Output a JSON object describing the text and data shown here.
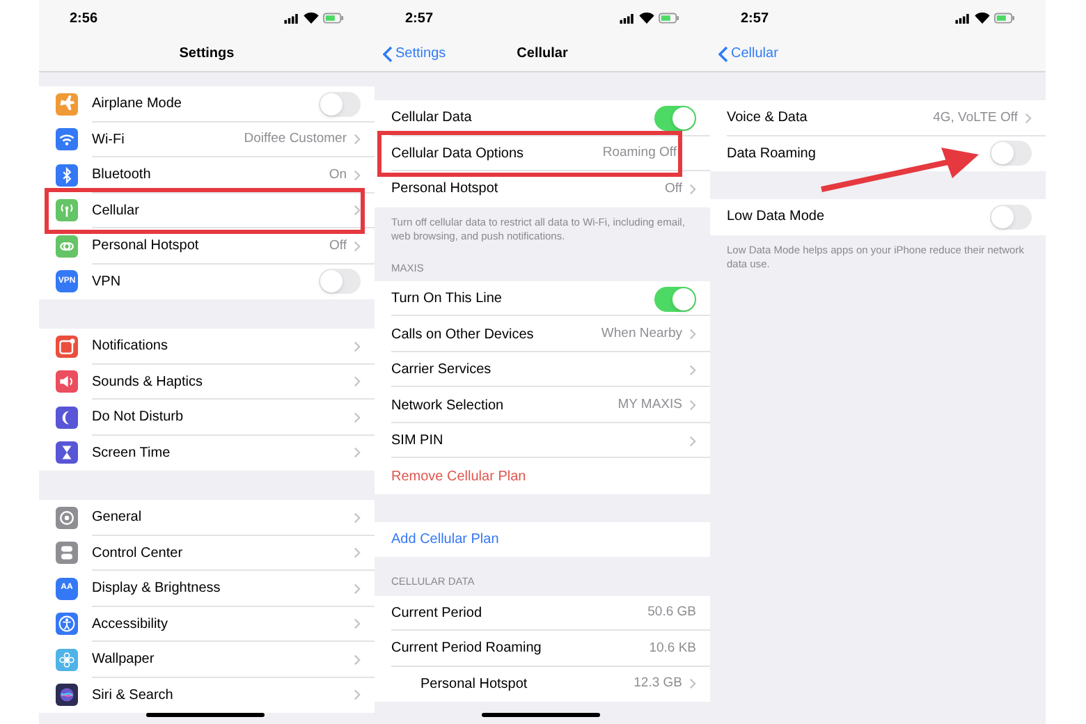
{
  "screens": [
    {
      "status_bar": {
        "time": "2:56"
      },
      "nav": {
        "title": "Settings"
      },
      "home_indicator": true,
      "groups": [
        {
          "rows": [
            {
              "kind": "toggle",
              "label": "Airplane Mode",
              "on": false,
              "color": "#f09a37",
              "highlighted": false
            },
            {
              "kind": "disclosure",
              "label": "Wi-Fi",
              "value": "Doiffee Customer",
              "color": "#3478f6",
              "highlighted": false
            },
            {
              "kind": "disclosure",
              "label": "Bluetooth",
              "value": "On",
              "color": "#3478f6",
              "highlighted": false
            },
            {
              "kind": "disclosure",
              "label": "Cellular",
              "color": "#65c466",
              "highlighted": true
            },
            {
              "kind": "disclosure",
              "label": "Personal Hotspot",
              "value": "Off",
              "color": "#65c466",
              "highlighted": false
            },
            {
              "kind": "toggle",
              "label": "VPN",
              "on": false,
              "color": "#3478f6",
              "icon_text": "VPN",
              "highlighted": false
            }
          ]
        },
        {
          "rows": [
            {
              "kind": "disclosure",
              "label": "Notifications",
              "color": "#eb4e3d",
              "highlighted": false
            },
            {
              "kind": "disclosure",
              "label": "Sounds & Haptics",
              "color": "#eb4e5f",
              "highlighted": false
            },
            {
              "kind": "disclosure",
              "label": "Do Not Disturb",
              "color": "#5856d6",
              "highlighted": false
            },
            {
              "kind": "disclosure",
              "label": "Screen Time",
              "color": "#5856d6",
              "highlighted": false
            }
          ]
        },
        {
          "rows": [
            {
              "kind": "disclosure",
              "label": "General",
              "color": "#8e8e93",
              "highlighted": false
            },
            {
              "kind": "disclosure",
              "label": "Control Center",
              "color": "#8e8e93",
              "highlighted": false
            },
            {
              "kind": "disclosure",
              "label": "Display & Brightness",
              "color": "#3478f6",
              "icon_text": "AA",
              "highlighted": false
            },
            {
              "kind": "disclosure",
              "label": "Accessibility",
              "color": "#3478f6",
              "highlighted": false
            },
            {
              "kind": "disclosure",
              "label": "Wallpaper",
              "color": "#4fb3e8",
              "highlighted": false
            },
            {
              "kind": "disclosure",
              "label": "Siri & Search",
              "color": "#2c2c54",
              "highlighted": false
            }
          ]
        }
      ]
    },
    {
      "status_bar": {
        "time": "2:57"
      },
      "nav": {
        "back": "Settings",
        "title": "Cellular"
      },
      "home_indicator": true,
      "groups": [
        {
          "rows": [
            {
              "kind": "toggle",
              "label": "Cellular Data",
              "on": true,
              "highlighted": false
            },
            {
              "kind": "value",
              "label": "Cellular Data Options",
              "value": "Roaming Off",
              "highlighted": true
            },
            {
              "kind": "disclosure",
              "label": "Personal Hotspot",
              "value": "Off",
              "highlighted": false
            }
          ],
          "footer": "Turn off cellular data to restrict all data to Wi-Fi, including email, web browsing, and push notifications."
        },
        {
          "header": "MAXIS",
          "rows": [
            {
              "kind": "toggle",
              "label": "Turn On This Line",
              "on": true,
              "highlighted": false
            },
            {
              "kind": "disclosure",
              "label": "Calls on Other Devices",
              "value": "When Nearby",
              "highlighted": false
            },
            {
              "kind": "disclosure",
              "label": "Carrier Services",
              "highlighted": false
            },
            {
              "kind": "disclosure",
              "label": "Network Selection",
              "value": "MY MAXIS",
              "highlighted": false
            },
            {
              "kind": "disclosure",
              "label": "SIM PIN",
              "highlighted": false
            },
            {
              "kind": "destructive",
              "label": "Remove Cellular Plan",
              "highlighted": false
            }
          ]
        },
        {
          "rows": [
            {
              "kind": "action",
              "label": "Add Cellular Plan",
              "highlighted": false
            }
          ]
        },
        {
          "header": "CELLULAR DATA",
          "rows": [
            {
              "kind": "value",
              "label": "Current Period",
              "value": "50.6 GB",
              "highlighted": false
            },
            {
              "kind": "value",
              "label": "Current Period Roaming",
              "value": "10.6 KB",
              "highlighted": false
            },
            {
              "kind": "sub",
              "label": "Personal Hotspot",
              "value": "12.3 GB",
              "highlighted": false
            }
          ]
        }
      ]
    },
    {
      "status_bar": {
        "time": "2:57"
      },
      "nav": {
        "back": "Cellular"
      },
      "home_indicator": false,
      "arrow": true,
      "groups": [
        {
          "rows": [
            {
              "kind": "disclosure",
              "label": "Voice & Data",
              "value": "4G, VoLTE Off",
              "highlighted": false
            },
            {
              "kind": "toggle",
              "label": "Data Roaming",
              "on": false,
              "highlighted": false
            }
          ]
        },
        {
          "rows": [
            {
              "kind": "toggle",
              "label": "Low Data Mode",
              "on": false,
              "highlighted": false
            }
          ],
          "footer": "Low Data Mode helps apps on your iPhone reduce their network data use."
        }
      ]
    }
  ]
}
